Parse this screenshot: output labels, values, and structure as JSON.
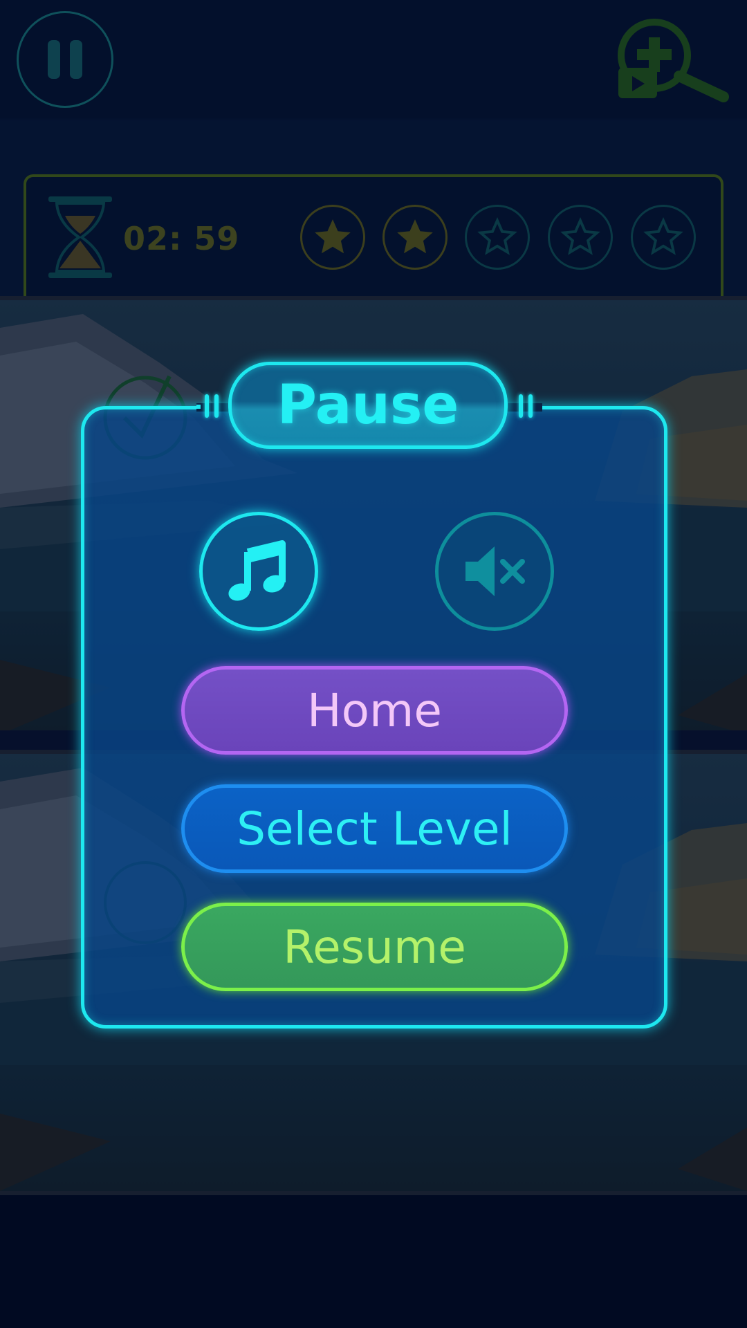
{
  "header": {
    "pause_icon": "pause-icon",
    "hint_icon": "magnifier-plus-video-icon"
  },
  "status": {
    "timer": "02: 59",
    "stars": [
      {
        "state": "filled"
      },
      {
        "state": "filled"
      },
      {
        "state": "empty"
      },
      {
        "state": "empty"
      },
      {
        "state": "empty"
      }
    ]
  },
  "dialog": {
    "title": "Pause",
    "music_icon": "music-note-icon",
    "mute_icon": "speaker-mute-icon",
    "home_label": "Home",
    "select_level_label": "Select Level",
    "resume_label": "Resume"
  },
  "colors": {
    "neon_cyan": "#1ee8ef",
    "home_purple": "#b466f2",
    "level_blue": "#1e8ef0",
    "resume_green": "#7cf04a",
    "star_gold": "#6e6a14"
  }
}
